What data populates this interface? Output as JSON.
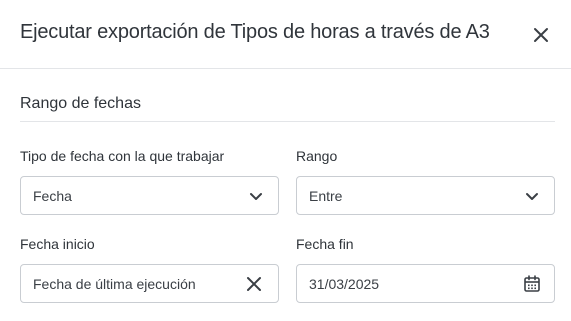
{
  "dialog": {
    "title": "Ejecutar exportación de Tipos de horas a través de A3",
    "close_icon": "close-icon"
  },
  "section": {
    "title": "Rango de fechas"
  },
  "fields": {
    "date_type": {
      "label": "Tipo de fecha con la que trabajar",
      "value": "Fecha",
      "icon": "chevron-down-icon"
    },
    "range": {
      "label": "Rango",
      "value": "Entre",
      "icon": "chevron-down-icon"
    },
    "start_date": {
      "label": "Fecha inicio",
      "value": "Fecha de última ejecución",
      "icon": "clear-icon"
    },
    "end_date": {
      "label": "Fecha fin",
      "value": "31/03/2025",
      "icon": "calendar-icon"
    }
  }
}
